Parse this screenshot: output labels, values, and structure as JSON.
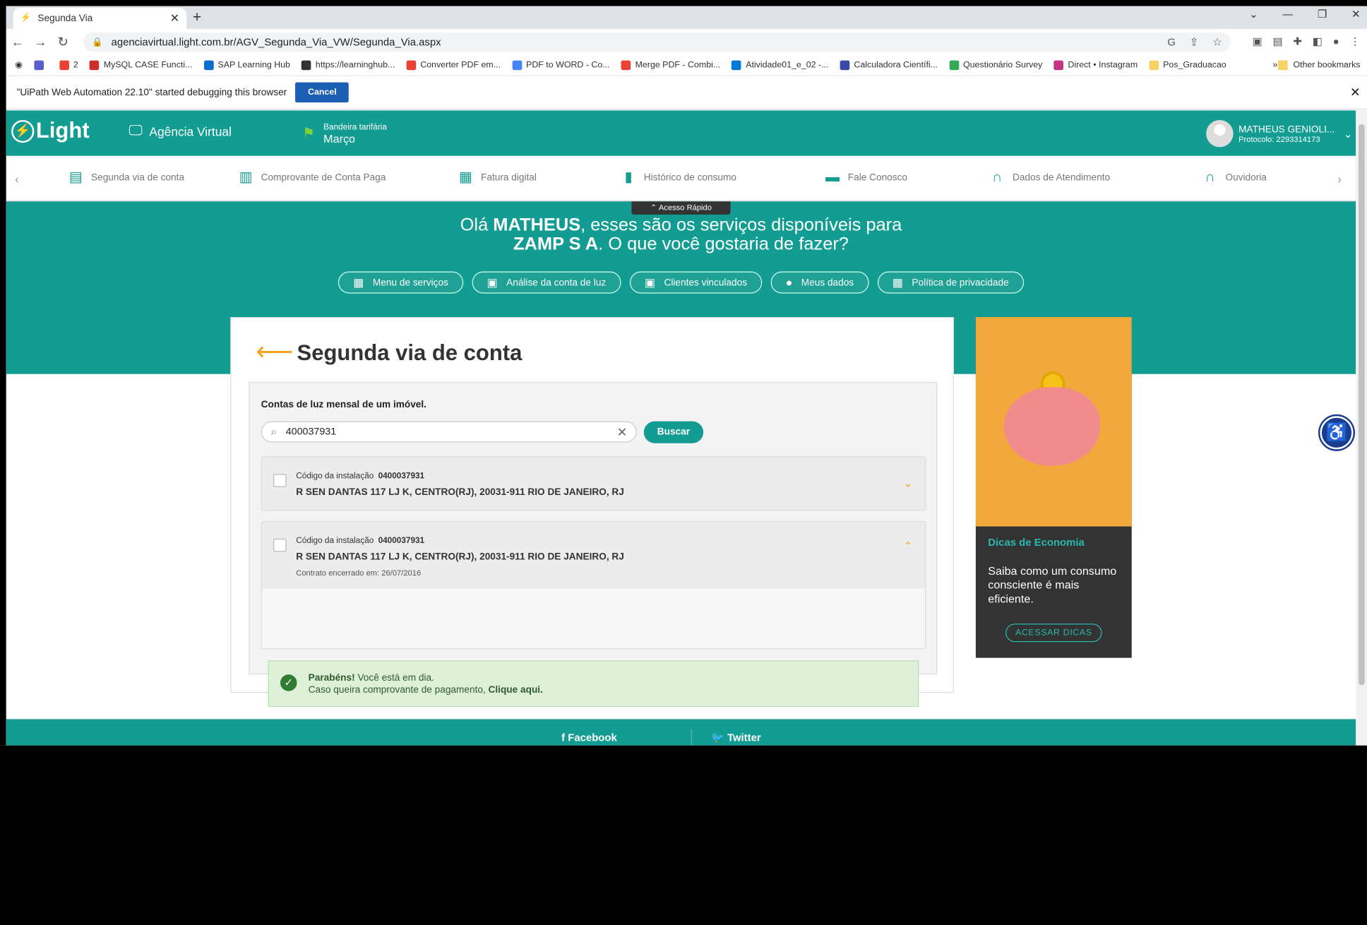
{
  "browser": {
    "tab_title": "Segunda Via",
    "url": "agenciavirtual.light.com.br/AGV_Segunda_Via_VW/Segunda_Via.aspx",
    "bookmarks": [
      {
        "label": "2",
        "color": "#e94335"
      },
      {
        "label": "MySQL CASE Functi...",
        "color": "#c9302c"
      },
      {
        "label": "SAP Learning Hub",
        "color": "#0a6ed1"
      },
      {
        "label": "https://learninghub...",
        "color": "#333333"
      },
      {
        "label": "Converter PDF em...",
        "color": "#e94335"
      },
      {
        "label": "PDF to WORD - Co...",
        "color": "#4285f4"
      },
      {
        "label": "Merge PDF - Combi...",
        "color": "#e94335"
      },
      {
        "label": "Atividade01_e_02 -...",
        "color": "#0078d4"
      },
      {
        "label": "Calculadora Científi...",
        "color": "#3949ab"
      },
      {
        "label": "Questionário Survey",
        "color": "#34a853"
      },
      {
        "label": "Direct • Instagram",
        "color": "#c13584"
      },
      {
        "label": "Pos_Graduacao",
        "color": "#f6d365"
      }
    ],
    "other_bookmarks": "Other bookmarks",
    "infobar_text": "\"UiPath Web Automation 22.10\" started debugging this browser",
    "infobar_cancel": "Cancel"
  },
  "header": {
    "logo": "Light",
    "agencia": "Agência Virtual",
    "bandeira_label": "Bandeira tarifária",
    "bandeira_value": "Março",
    "user_name": "MATHEUS GENIOLI...",
    "protocolo": "Protocolo: 2293314173"
  },
  "nav": [
    {
      "label": "Segunda via de conta",
      "icon": "bill-icon"
    },
    {
      "label": "Comprovante de Conta Paga",
      "icon": "receipt-icon"
    },
    {
      "label": "Fatura digital",
      "icon": "digital-invoice-icon"
    },
    {
      "label": "Histórico de consumo",
      "icon": "chart-icon"
    },
    {
      "label": "Fale Conosco",
      "icon": "chat-icon"
    },
    {
      "label": "Dados de Atendimento",
      "icon": "headset-icon"
    },
    {
      "label": "Ouvidoria",
      "icon": "headset-icon"
    }
  ],
  "acesso_rapido": "Acesso Rápido",
  "greeting": {
    "pre": "Olá ",
    "name": "MATHEUS",
    "mid": ", esses são os serviços disponíveis para",
    "company": "ZAMP S A",
    "post": ". O que você gostaria de fazer?"
  },
  "pills": [
    {
      "label": "Menu de serviços",
      "icon": "grid-icon"
    },
    {
      "label": "Análise da conta de luz",
      "icon": "contact-card-icon"
    },
    {
      "label": "Clientes vinculados",
      "icon": "contact-card-icon"
    },
    {
      "label": "Meus dados",
      "icon": "person-icon"
    },
    {
      "label": "Política de privacidade",
      "icon": "grid-icon"
    }
  ],
  "main": {
    "title": "Segunda via de conta",
    "section_label": "Contas de luz mensal de um imóvel.",
    "search_value": "400037931",
    "search_button": "Buscar",
    "items": [
      {
        "code_label": "Código da instalação",
        "code": "0400037931",
        "address": "R SEN DANTAS 117 LJ K, CENTRO(RJ), 20031-911 RIO DE JANEIRO, RJ"
      },
      {
        "code_label": "Código da instalação",
        "code": "0400037931",
        "address": "R SEN DANTAS 117 LJ K, CENTRO(RJ), 20031-911 RIO DE JANEIRO, RJ",
        "contract_end": "Contrato encerrado em: 26/07/2016"
      }
    ],
    "alert": {
      "bold": "Parabéns!",
      "text": " Você está em dia.",
      "line2": "Caso queira comprovante de pagamento, ",
      "link": "Clique aqui."
    }
  },
  "promo": {
    "heading": "Dicas de Economia",
    "text": "Saiba como um consumo consciente é mais eficiente.",
    "button": "ACESSAR DICAS"
  },
  "footer": {
    "facebook": "Facebook",
    "twitter": "Twitter"
  }
}
